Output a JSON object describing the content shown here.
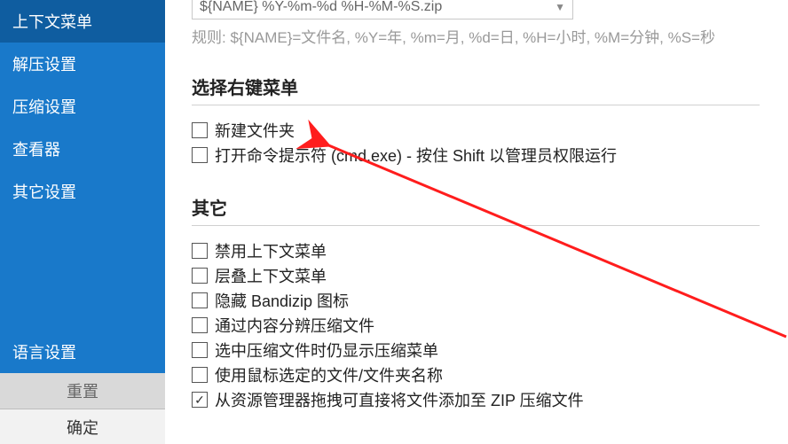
{
  "sidebar": {
    "items": [
      {
        "label": "上下文菜单",
        "name": "sidebar-item-context-menu"
      },
      {
        "label": "解压设置",
        "name": "sidebar-item-extract"
      },
      {
        "label": "压缩设置",
        "name": "sidebar-item-compress"
      },
      {
        "label": "查看器",
        "name": "sidebar-item-viewer"
      },
      {
        "label": "其它设置",
        "name": "sidebar-item-other"
      },
      {
        "label": "语言设置",
        "name": "sidebar-item-language"
      }
    ],
    "reset_label": "重置",
    "ok_label": "确定"
  },
  "format": {
    "value": "${NAME} %Y-%m-%d %H-%M-%S.zip",
    "rule": "规则: ${NAME}=文件名, %Y=年, %m=月, %d=日, %H=小时, %M=分钟, %S=秒"
  },
  "section_right_click": {
    "title": "选择右键菜单",
    "items": [
      {
        "label": "新建文件夹",
        "checked": false,
        "name": "cb-new-folder"
      },
      {
        "label": "打开命令提示符 (cmd.exe) - 按住 Shift 以管理员权限运行",
        "checked": false,
        "name": "cb-open-cmd"
      }
    ]
  },
  "section_other": {
    "title": "其它",
    "items": [
      {
        "label": "禁用上下文菜单",
        "checked": false,
        "name": "cb-disable-ctx"
      },
      {
        "label": "层叠上下文菜单",
        "checked": false,
        "name": "cb-cascade-ctx"
      },
      {
        "label": "隐藏 Bandizip 图标",
        "checked": false,
        "name": "cb-hide-icon"
      },
      {
        "label": "通过内容分辨压缩文件",
        "checked": false,
        "name": "cb-detect-content"
      },
      {
        "label": "选中压缩文件时仍显示压缩菜单",
        "checked": false,
        "name": "cb-show-menu"
      },
      {
        "label": "使用鼠标选定的文件/文件夹名称",
        "checked": false,
        "name": "cb-mouse-name"
      },
      {
        "label": "从资源管理器拖拽可直接将文件添加至 ZIP 压缩文件",
        "checked": true,
        "name": "cb-drag-zip"
      }
    ]
  }
}
